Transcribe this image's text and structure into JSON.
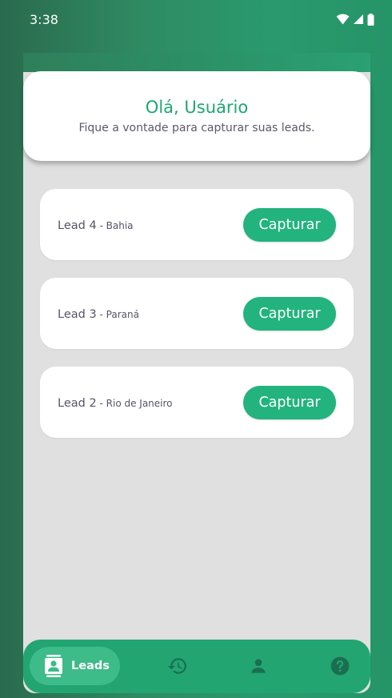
{
  "status_bar": {
    "time": "3:38"
  },
  "header": {
    "title": "Olá, Usuário",
    "subtitle": "Fique a vontade para capturar suas leads."
  },
  "leads": [
    {
      "name": "Lead 4",
      "separator": " - ",
      "location": "Bahia",
      "button_label": "Capturar"
    },
    {
      "name": "Lead 3",
      "separator": " - ",
      "location": "Paraná",
      "button_label": "Capturar"
    },
    {
      "name": "Lead 2",
      "separator": " - ",
      "location": "Rio de Janeiro",
      "button_label": "Capturar"
    }
  ],
  "bottom_nav": {
    "items": [
      {
        "icon": "contact-badge-icon",
        "label": "Leads",
        "active": true
      },
      {
        "icon": "history-icon",
        "active": false
      },
      {
        "icon": "person-icon",
        "active": false
      },
      {
        "icon": "help-icon",
        "active": false
      }
    ]
  },
  "colors": {
    "accent": "#22b37e",
    "title_green": "#1fa673",
    "nav_bg": "#22a571",
    "nav_active_bg": "#3dbb88",
    "nav_icon": "#1a6e50"
  }
}
